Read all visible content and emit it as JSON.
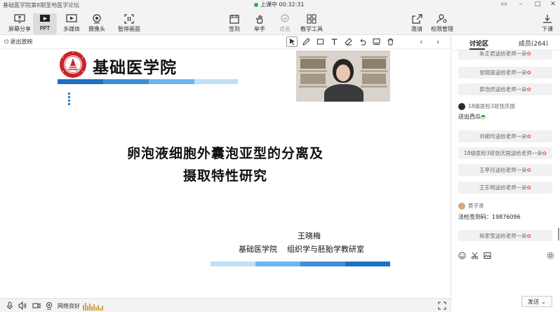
{
  "window": {
    "title": "基础医学院第8期圣地医学论坛",
    "live_status": "上课中 00:32:31"
  },
  "toolbar": {
    "left": [
      {
        "id": "screen-share",
        "label": "屏幕分享"
      },
      {
        "id": "ppt",
        "label": "PPT"
      },
      {
        "id": "media",
        "label": "多媒体"
      },
      {
        "id": "camera",
        "label": "摄像头"
      },
      {
        "id": "pause",
        "label": "暂停画面"
      }
    ],
    "center": [
      {
        "id": "signin",
        "label": "签到"
      },
      {
        "id": "raise-hand",
        "label": "举手"
      },
      {
        "id": "rollcall",
        "label": "点名"
      },
      {
        "id": "teach-tools",
        "label": "教学工具"
      }
    ],
    "right": [
      {
        "id": "invite",
        "label": "邀请"
      },
      {
        "id": "permissions",
        "label": "权限管理"
      },
      {
        "id": "leave",
        "label": "下课"
      }
    ]
  },
  "stage": {
    "exit_label": "退出放映"
  },
  "slide": {
    "school_name": "基础医学院",
    "title_line1": "卵泡液细胞外囊泡亚型的分离及",
    "title_line2": "摄取特性研究",
    "author": "王晓梅",
    "department": "基础医学院    组织学与胚胎学教研室"
  },
  "statusbar": {
    "network": "网络良好"
  },
  "sidebar": {
    "tab_discussion": "讨论区",
    "tab_members": "成员(264)",
    "messages": [
      {
        "type": "flower",
        "text": "朱正君送给老师一朵"
      },
      {
        "type": "flower",
        "text": "张晓丽送给老师一朵"
      },
      {
        "type": "flower",
        "text": "郭浩然送给老师一朵"
      },
      {
        "type": "user",
        "user": "18级医检3班张庆国",
        "text": "送出西瓜"
      },
      {
        "type": "flower",
        "text": "刘艳玲送给老师一朵"
      },
      {
        "type": "flower",
        "text": "18级医检3班张庆国送给老师一朵"
      },
      {
        "type": "flower",
        "text": "王亭月送给老师一朵"
      },
      {
        "type": "flower",
        "text": "王东明送给老师一朵"
      },
      {
        "type": "user",
        "user": "黄子贤",
        "text": "法检签到码：19876096"
      },
      {
        "type": "flower",
        "text": "和家莹送给老师一朵"
      }
    ],
    "send_label": "发送"
  },
  "colors": {
    "accent_blue": "#1f6fc2",
    "light_blue": "#5eaee8",
    "pale_blue": "#bfe0f7",
    "flower": "#e05a4a"
  }
}
